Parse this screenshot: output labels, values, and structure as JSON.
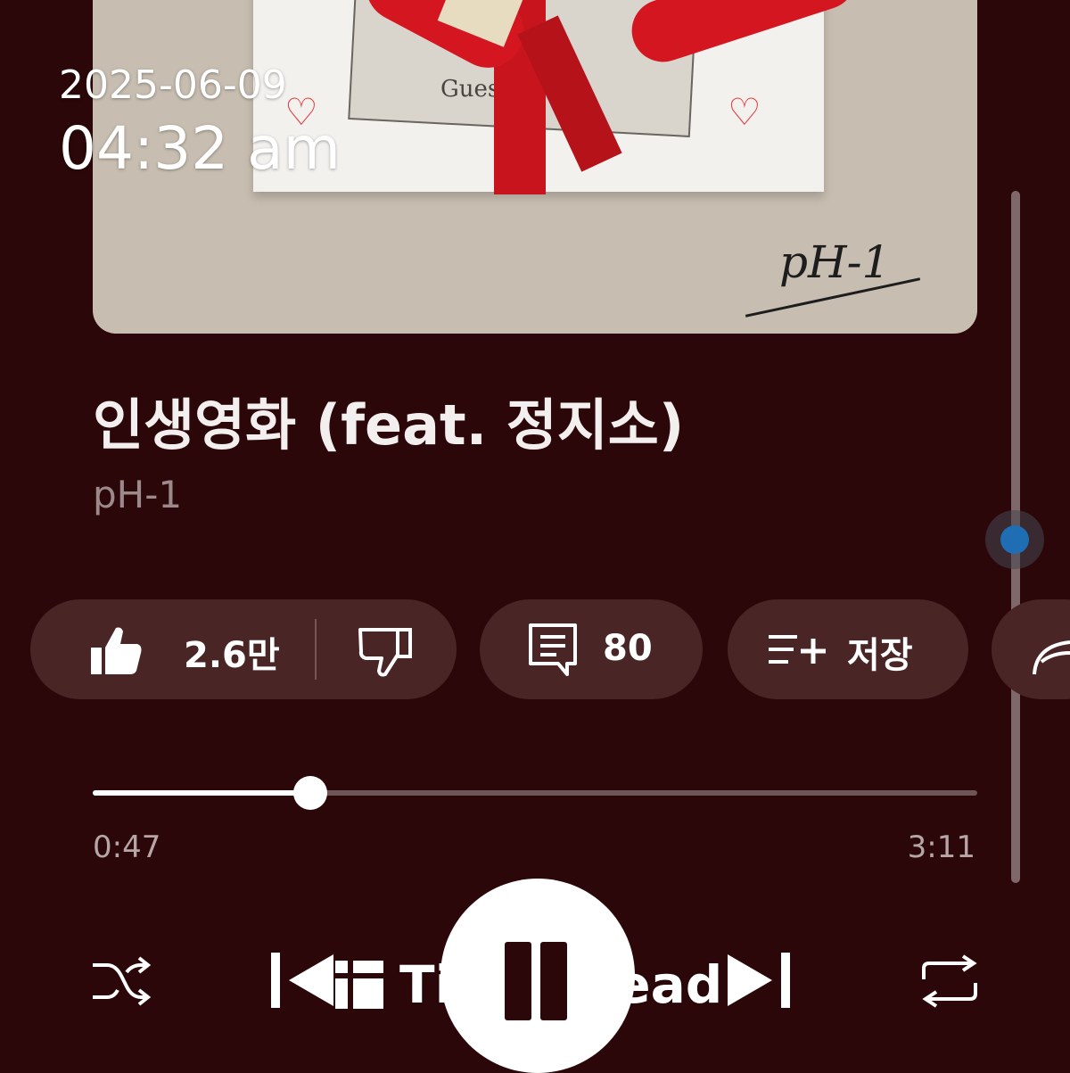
{
  "overlay": {
    "date": "2025-06-09",
    "time": "04:32 am"
  },
  "album_art": {
    "box_text": "Guess Fool",
    "signature": "pH-1"
  },
  "track": {
    "title": "인생영화 (feat. 정지소)",
    "artist": "pH-1"
  },
  "actions": {
    "like_count": "2.6만",
    "comment_count": "80",
    "save_label": "저장"
  },
  "progress": {
    "elapsed": "0:47",
    "total": "3:11",
    "fraction": 0.246
  },
  "watermark": {
    "text": "TimesHead"
  },
  "colors": {
    "background": "#2b0709",
    "pill": "#4a2526",
    "scroll_accent": "#1f6db3"
  },
  "icons": [
    "like-icon",
    "dislike-icon",
    "comment-icon",
    "save-playlist-icon",
    "share-icon",
    "shuffle-icon",
    "previous-icon",
    "pause-icon",
    "next-icon",
    "repeat-icon"
  ]
}
